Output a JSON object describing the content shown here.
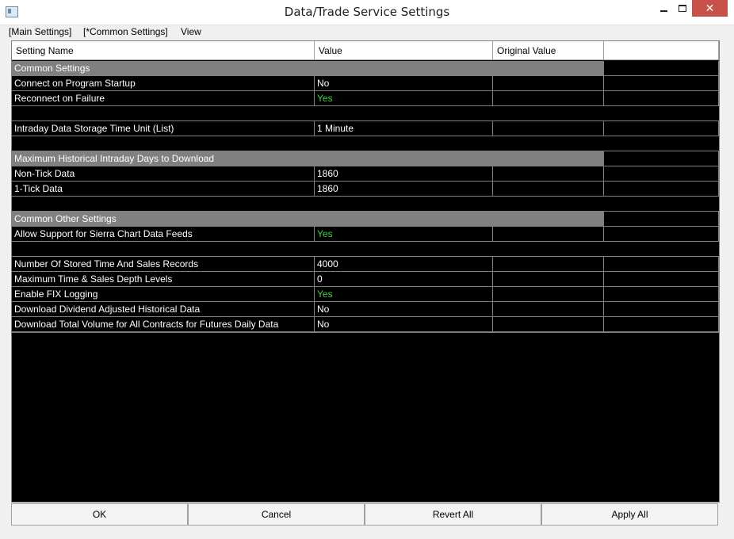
{
  "window": {
    "title": "Data/Trade Service Settings",
    "close_glyph": "✕"
  },
  "menu": [
    "[Main Settings]",
    "[*Common Settings]",
    "View"
  ],
  "columns": [
    "Setting Name",
    "Value",
    "Original Value",
    ""
  ],
  "rows": [
    {
      "type": "section",
      "name": "Common Settings",
      "value": "",
      "original": ""
    },
    {
      "type": "setting",
      "name": "Connect on Program Startup",
      "value": "No",
      "original": ""
    },
    {
      "type": "setting",
      "name": "Reconnect on Failure",
      "value": "Yes",
      "original": ""
    },
    {
      "type": "blank",
      "name": "",
      "value": "",
      "original": ""
    },
    {
      "type": "setting",
      "name": "Intraday Data Storage Time Unit (List)",
      "value": "1 Minute",
      "original": ""
    },
    {
      "type": "blank",
      "name": "",
      "value": "",
      "original": ""
    },
    {
      "type": "section",
      "name": "Maximum Historical Intraday Days to Download",
      "value": "",
      "original": ""
    },
    {
      "type": "setting",
      "name": "Non-Tick Data",
      "value": "1860",
      "original": ""
    },
    {
      "type": "setting",
      "name": "1-Tick Data",
      "value": "1860",
      "original": ""
    },
    {
      "type": "blank",
      "name": "",
      "value": "",
      "original": ""
    },
    {
      "type": "section",
      "name": "Common Other Settings",
      "value": "",
      "original": ""
    },
    {
      "type": "setting",
      "name": "Allow Support for Sierra Chart Data Feeds",
      "value": "Yes",
      "original": ""
    },
    {
      "type": "blank",
      "name": "",
      "value": "",
      "original": ""
    },
    {
      "type": "setting",
      "name": "Number Of Stored Time And Sales Records",
      "value": "4000",
      "original": ""
    },
    {
      "type": "setting",
      "name": "Maximum Time & Sales Depth Levels",
      "value": "0",
      "original": ""
    },
    {
      "type": "setting",
      "name": "Enable FIX Logging",
      "value": "Yes",
      "original": ""
    },
    {
      "type": "setting",
      "name": "Download Dividend Adjusted Historical Data",
      "value": "No",
      "original": ""
    },
    {
      "type": "setting",
      "name": "Download Total Volume for All Contracts for Futures Daily Data",
      "value": "No",
      "original": ""
    }
  ],
  "buttons": {
    "ok": "OK",
    "cancel": "Cancel",
    "revert_all": "Revert All",
    "apply_all": "Apply All"
  },
  "colors": {
    "yes_value": "#3fd13f",
    "section_bg": "#808080",
    "grid_bg": "#000000",
    "close_button": "#c7504a"
  }
}
